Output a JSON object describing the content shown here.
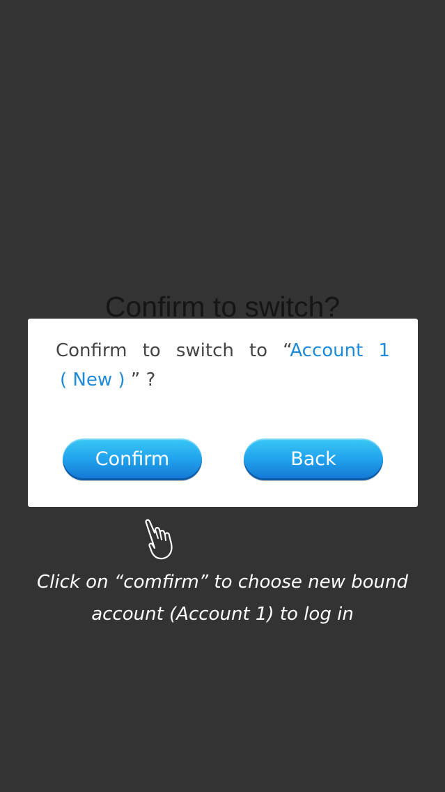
{
  "title": "Confirm to switch?",
  "dialog": {
    "message_prefix": "Confirm",
    "message_word2": "to",
    "message_word3": "switch",
    "message_word4": "to",
    "open_quote": "“",
    "account_part1": "Account",
    "account_part2": "1",
    "account_part3": "( New )",
    "close_quote_mark": "” ?",
    "confirm_label": "Confirm",
    "back_label": "Back"
  },
  "instruction": {
    "line1": "Click on “comfirm”  to choose new bound",
    "line2": "account (Account 1)  to log in"
  },
  "colors": {
    "background": "#333333",
    "link": "#1f8ad8",
    "button": "#22a6ee"
  },
  "icons": {
    "pointer": "hand-pointer-icon"
  }
}
